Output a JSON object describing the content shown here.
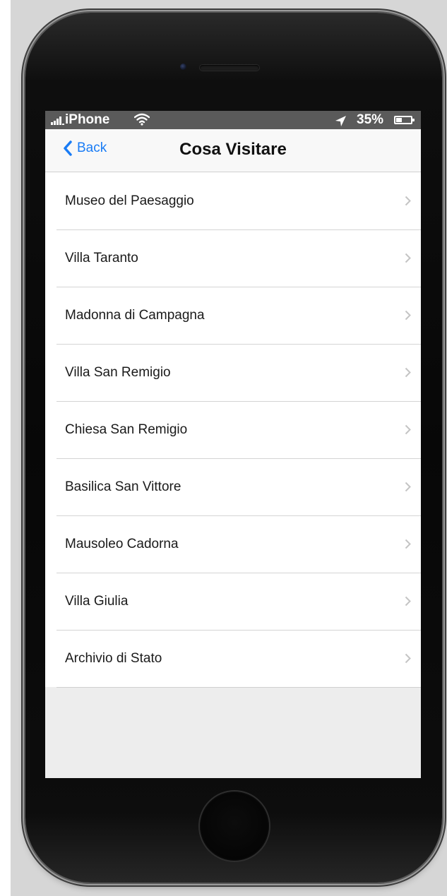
{
  "status_bar": {
    "carrier": "iPhone",
    "battery_percent": "35%",
    "icons": [
      "signal-icon",
      "wifi-icon",
      "location-icon",
      "battery-icon"
    ]
  },
  "nav": {
    "back_label": "Back",
    "title": "Cosa Visitare"
  },
  "places": [
    "Museo del Paesaggio",
    "Villa Taranto",
    "Madonna di Campagna",
    "Villa San Remigio",
    "Chiesa San Remigio",
    "Basilica San Vittore",
    "Mausoleo Cadorna",
    "Villa Giulia",
    "Archivio di Stato"
  ],
  "colors": {
    "accent": "#1a7cf5",
    "status_bar_bg": "#5a5a5a",
    "nav_bg": "#f8f8f8",
    "screen_bg": "#ededed",
    "chevron": "#c4c4c4"
  }
}
